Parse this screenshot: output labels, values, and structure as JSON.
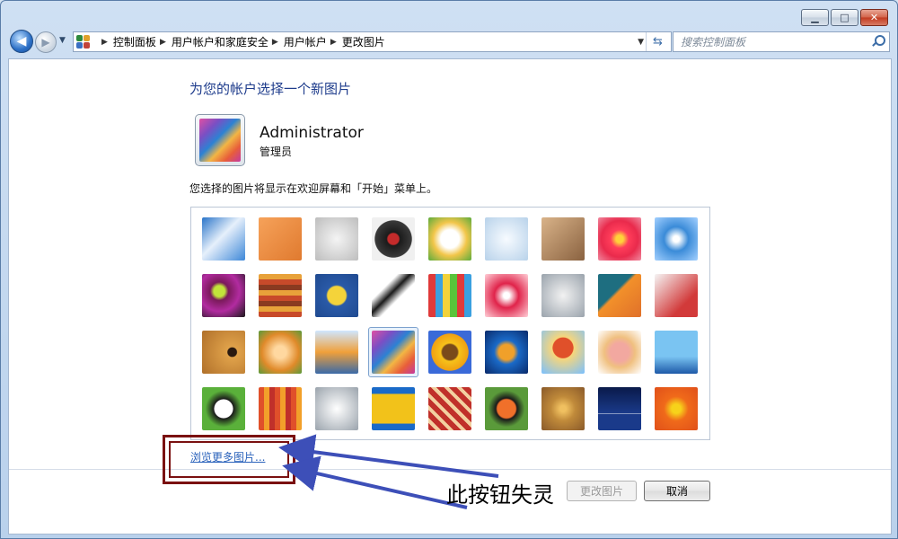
{
  "window": {
    "caption_buttons": [
      "minimize",
      "maximize",
      "close"
    ]
  },
  "nav": {
    "breadcrumbs": [
      "控制面板",
      "用户帐户和家庭安全",
      "用户帐户",
      "更改图片"
    ],
    "search_placeholder": "搜索控制面板"
  },
  "page": {
    "heading": "为您的帐户选择一个新图片",
    "account_name": "Administrator",
    "account_role": "管理员",
    "hint": "您选择的图片将显示在欢迎屏幕和「开始」菜单上。",
    "browse_link": "浏览更多图片...",
    "change_button": "更改图片",
    "cancel_button": "取消"
  },
  "pictures": [
    "roller-coaster",
    "starfish",
    "robot-toy",
    "vinyl-record",
    "lucky-cat",
    "spinning-top",
    "kitten",
    "pink-flower",
    "pinwheel",
    "ball",
    "fabric-stack",
    "yellow-leaf",
    "border-collie",
    "crayons",
    "star-ornament",
    "jacks",
    "stairs",
    "paper-crane",
    "guitar",
    "pomeranian",
    "toy-robot",
    "colorful-swirl",
    "sunflower",
    "tropical-fish",
    "hot-air-balloon",
    "doll",
    "sailboat",
    "soccer-ball",
    "fabric",
    "marbles",
    "window",
    "textile",
    "butterfly",
    "basket-weave",
    "lighthouse",
    "orange-flower"
  ],
  "selected_picture": "colorful-swirl",
  "annotation": {
    "text": "此按钮失灵"
  },
  "colors": {
    "heading": "#1e3c8c",
    "link": "#2a62bb",
    "annotation_box": "#7a1010",
    "annotation_arrow": "#3d4fb8"
  }
}
